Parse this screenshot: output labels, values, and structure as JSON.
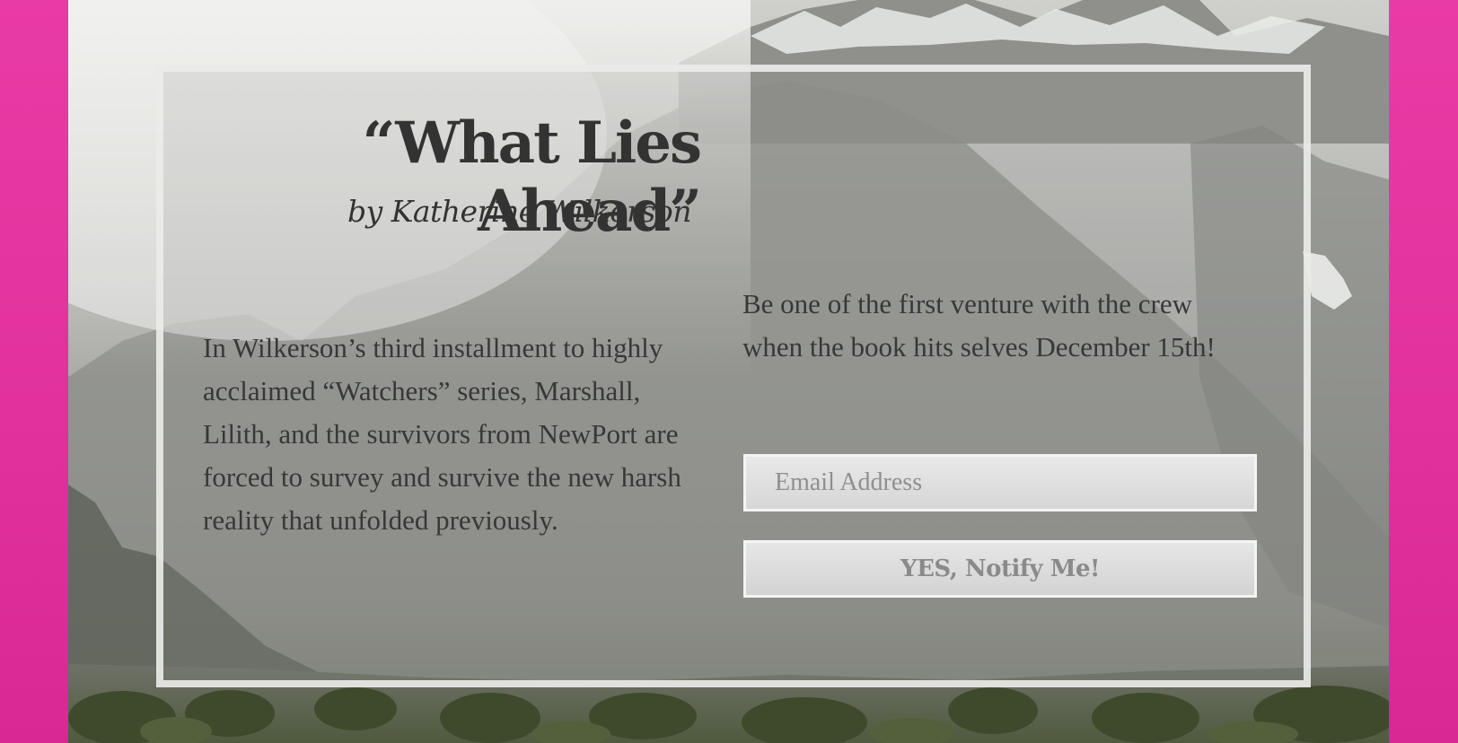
{
  "page": {
    "accent_color": "#e2319c"
  },
  "book": {
    "title": "“What Lies Ahead”",
    "byline": "by Katherine Wilkerson",
    "description": "In Wilkerson’s third installment to highly acclaimed “Watchers” series, Marshall, Lilith, and the survivors from NewPort are forced to survey and survive the new harsh reality that unfolded previously."
  },
  "signup": {
    "promo_text": "Be one of the first venture with the crew when the book hits selves December 15th!",
    "email_placeholder": "Email Address",
    "email_value": "",
    "button_label": "YES, Notify Me!"
  }
}
